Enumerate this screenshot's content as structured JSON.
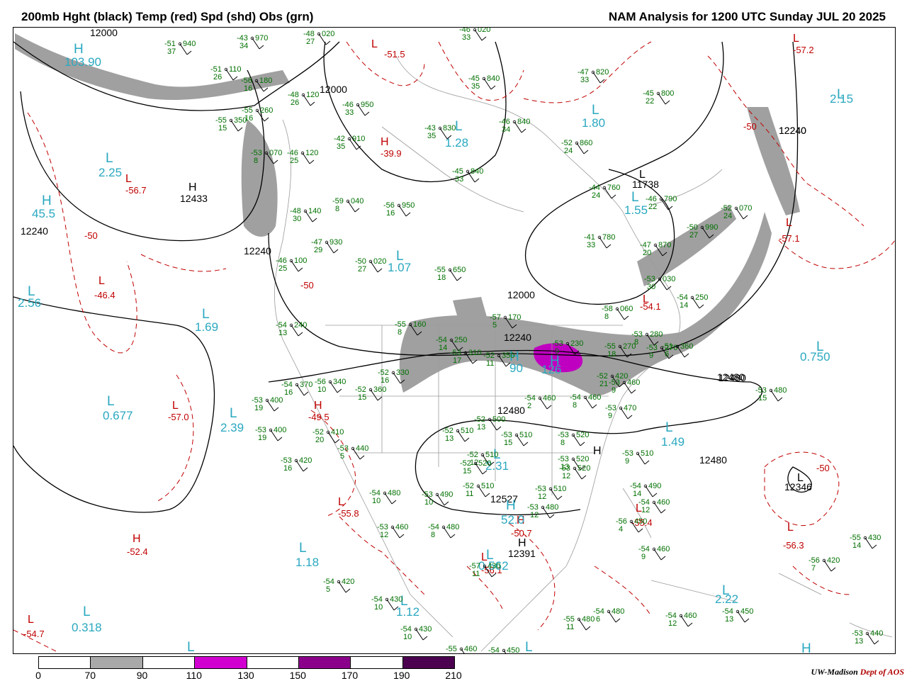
{
  "header": {
    "title_left": "200mb Hght (black) Temp (red) Spd (shd) Obs (grn)",
    "title_right": "NAM Analysis for 1200 UTC Sunday  JUL 20 2025"
  },
  "credit": {
    "org": "UW-Madison",
    "dept": "Dept of AOS"
  },
  "legend": {
    "ticks": [
      "0",
      "70",
      "90",
      "110",
      "130",
      "150",
      "170",
      "190",
      "210"
    ],
    "segments": [
      {
        "from": "0",
        "to": "70",
        "color": "#ffffff"
      },
      {
        "from": "70",
        "to": "90",
        "color": "#a9a9a9"
      },
      {
        "from": "90",
        "to": "110",
        "color": "#ffffff"
      },
      {
        "from": "110",
        "to": "130",
        "color": "#d100d1"
      },
      {
        "from": "130",
        "to": "150",
        "color": "#ffffff"
      },
      {
        "from": "150",
        "to": "170",
        "color": "#8b008b"
      },
      {
        "from": "170",
        "to": "190",
        "color": "#ffffff"
      },
      {
        "from": "190",
        "to": "210",
        "color": "#4b0050"
      }
    ]
  },
  "colors": {
    "height": "#000000",
    "temp": "#c00000",
    "speed_hi": "#a0a0a0",
    "obs": "#007000",
    "cyan": "#2aa8c0",
    "jet_core": "#c000c0"
  },
  "height_labels": [
    "12000",
    "12000",
    "12240",
    "12433",
    "12240",
    "12240",
    "11738",
    "12000",
    "12240",
    "12480",
    "12480",
    "12480",
    "12527",
    "12346",
    "12391",
    "12480",
    "12240"
  ],
  "height_centers": [
    {
      "type": "H",
      "value": "12433"
    },
    {
      "type": "L",
      "value": "11738"
    },
    {
      "type": "H",
      "value": "12527"
    },
    {
      "type": "L",
      "value": "12346"
    },
    {
      "type": "H",
      "value": "12391"
    }
  ],
  "temp_centers": [
    {
      "type": "L",
      "value": "-51.5"
    },
    {
      "type": "H",
      "value": "-39.9"
    },
    {
      "type": "L",
      "value": "-56.7"
    },
    {
      "type": "L",
      "value": "-46.4"
    },
    {
      "type": "L",
      "value": "-57.0"
    },
    {
      "type": "H",
      "value": "-49.5"
    },
    {
      "type": "L",
      "value": "-55.8"
    },
    {
      "type": "H",
      "value": "-52.4"
    },
    {
      "type": "L",
      "value": "-54.7"
    },
    {
      "type": "H",
      "value": "-50.7"
    },
    {
      "type": "L",
      "value": "-56.1"
    },
    {
      "type": "L",
      "value": "-55.4"
    },
    {
      "type": "L",
      "value": "-56.3"
    },
    {
      "type": "L",
      "value": "-57.2"
    },
    {
      "type": "L",
      "value": "-57.1"
    },
    {
      "type": "L",
      "value": "-54.1"
    }
  ],
  "temp_contour_labels": [
    "-50",
    "-50",
    "-50",
    "-50"
  ],
  "speed_centers": [
    {
      "type": "H",
      "value": "103.90"
    },
    {
      "type": "L",
      "value": "2.25"
    },
    {
      "type": "H",
      "value": "45.5"
    },
    {
      "type": "L",
      "value": "2.56"
    },
    {
      "type": "L",
      "value": "1.69"
    },
    {
      "type": "L",
      "value": "0.677"
    },
    {
      "type": "L",
      "value": "2.39"
    },
    {
      "type": "L",
      "value": "1.07"
    },
    {
      "type": "L",
      "value": "1.28"
    },
    {
      "type": "L",
      "value": "1.80"
    },
    {
      "type": "L",
      "value": "1.55"
    },
    {
      "type": "L",
      "value": "2.15"
    },
    {
      "type": "L",
      "value": "0.750"
    },
    {
      "type": "L",
      "value": "1.49"
    },
    {
      "type": "L",
      "value": "2.31"
    },
    {
      "type": "H",
      "value": "52.0"
    },
    {
      "type": "L",
      "value": "1.18"
    },
    {
      "type": "L",
      "value": "1.12"
    },
    {
      "type": "L",
      "value": "0.318"
    },
    {
      "type": "L",
      "value": "2.22"
    },
    {
      "type": "L",
      "value": "0.562"
    },
    {
      "type": "H",
      "value": "90"
    },
    {
      "type": "H",
      "value": "126"
    },
    {
      "type": "L",
      "value": ""
    },
    {
      "type": "L",
      "value": ""
    },
    {
      "type": "H",
      "value": ""
    }
  ],
  "observations": [
    {
      "t": "-43",
      "h": "970",
      "d": "34"
    },
    {
      "t": "-51",
      "h": "940",
      "d": "37"
    },
    {
      "t": "-48",
      "h": "020",
      "d": "27"
    },
    {
      "t": "-46",
      "h": "020",
      "d": "33"
    },
    {
      "t": "-51",
      "h": "110",
      "d": "26"
    },
    {
      "t": "-56",
      "h": "180",
      "d": "16"
    },
    {
      "t": "-48",
      "h": "120",
      "d": "26"
    },
    {
      "t": "-55",
      "h": "260",
      "d": "16"
    },
    {
      "t": "-55",
      "h": "350",
      "d": "15"
    },
    {
      "t": "-45",
      "h": "840",
      "d": "35"
    },
    {
      "t": "-47",
      "h": "820",
      "d": "33"
    },
    {
      "t": "-45",
      "h": "800",
      "d": "22"
    },
    {
      "t": "-46",
      "h": "950",
      "d": "33"
    },
    {
      "t": "-43",
      "h": "830",
      "d": "35"
    },
    {
      "t": "-46",
      "h": "840",
      "d": "34"
    },
    {
      "t": "-42",
      "h": "910",
      "d": "35"
    },
    {
      "t": "-52",
      "h": "860",
      "d": "24"
    },
    {
      "t": "-45",
      "h": "840",
      "d": "33"
    },
    {
      "t": "-53",
      "h": "070",
      "d": "8"
    },
    {
      "t": "-46",
      "h": "120",
      "d": "25"
    },
    {
      "t": "-44",
      "h": "760",
      "d": "24"
    },
    {
      "t": "-46",
      "h": "790",
      "d": "22"
    },
    {
      "t": "-59",
      "h": "040",
      "d": "8"
    },
    {
      "t": "-56",
      "h": "950",
      "d": "16"
    },
    {
      "t": "-48",
      "h": "140",
      "d": "30"
    },
    {
      "t": "-41",
      "h": "780",
      "d": "33"
    },
    {
      "t": "-47",
      "h": "870",
      "d": "20"
    },
    {
      "t": "-50",
      "h": "990",
      "d": "27"
    },
    {
      "t": "-52",
      "h": "070",
      "d": "24"
    },
    {
      "t": "-47",
      "h": "930",
      "d": "29"
    },
    {
      "t": "-50",
      "h": "020",
      "d": "27"
    },
    {
      "t": "-55",
      "h": "650",
      "d": "18"
    },
    {
      "t": "-46",
      "h": "100",
      "d": "25"
    },
    {
      "t": "-53",
      "h": "030",
      "d": "30"
    },
    {
      "t": "-54",
      "h": "250",
      "d": "14"
    },
    {
      "t": "-58",
      "h": "060",
      "d": "8"
    },
    {
      "t": "-54",
      "h": "240",
      "d": "13"
    },
    {
      "t": "-55",
      "h": "160",
      "d": "8"
    },
    {
      "t": "-57",
      "h": "170",
      "d": "5"
    },
    {
      "t": "-54",
      "h": "250",
      "d": "14"
    },
    {
      "t": "-53",
      "h": "310",
      "d": "17"
    },
    {
      "t": "-52",
      "h": "350",
      "d": "11"
    },
    {
      "t": "-55",
      "h": "270",
      "d": "18"
    },
    {
      "t": "-53",
      "h": "280",
      "d": "8"
    },
    {
      "t": "-53",
      "h": "270",
      "d": "9"
    },
    {
      "t": "-51",
      "h": "360",
      "d": "6"
    },
    {
      "t": "-53",
      "h": "230",
      "d": "9"
    },
    {
      "t": "-56",
      "h": "340",
      "d": "10"
    },
    {
      "t": "-52",
      "h": "330",
      "d": "16"
    },
    {
      "t": "-54",
      "h": "370",
      "d": "16"
    },
    {
      "t": "-52",
      "h": "360",
      "d": "15"
    },
    {
      "t": "-53",
      "h": "400",
      "d": "19"
    },
    {
      "t": "-52",
      "h": "420",
      "d": "21"
    },
    {
      "t": "-53",
      "h": "460",
      "d": "9"
    },
    {
      "t": "-53",
      "h": "480",
      "d": "15"
    },
    {
      "t": "-54",
      "h": "460",
      "d": "2"
    },
    {
      "t": "-54",
      "h": "460",
      "d": "8"
    },
    {
      "t": "-53",
      "h": "470",
      "d": "9"
    },
    {
      "t": "-53",
      "h": "400",
      "d": "19"
    },
    {
      "t": "-52",
      "h": "410",
      "d": "20"
    },
    {
      "t": "-52",
      "h": "500",
      "d": "13"
    },
    {
      "t": "-52",
      "h": "510",
      "d": "13"
    },
    {
      "t": "-53",
      "h": "520",
      "d": "8"
    },
    {
      "t": "-53",
      "h": "440",
      "d": "5"
    },
    {
      "t": "-52",
      "h": "510",
      "d": "12"
    },
    {
      "t": "-53",
      "h": "510",
      "d": "15"
    },
    {
      "t": "-53",
      "h": "520",
      "d": "13"
    },
    {
      "t": "-53",
      "h": "510",
      "d": "9"
    },
    {
      "t": "-53",
      "h": "420",
      "d": "16"
    },
    {
      "t": "-52",
      "h": "520",
      "d": "15"
    },
    {
      "t": "-53",
      "h": "520",
      "d": "12"
    },
    {
      "t": "-54",
      "h": "490",
      "d": "14"
    },
    {
      "t": "-54",
      "h": "480",
      "d": "10"
    },
    {
      "t": "-53",
      "h": "490",
      "d": "10"
    },
    {
      "t": "-52",
      "h": "510",
      "d": "11"
    },
    {
      "t": "-53",
      "h": "510",
      "d": "12"
    },
    {
      "t": "-53",
      "h": "480",
      "d": "12"
    },
    {
      "t": "-54",
      "h": "460",
      "d": "12"
    },
    {
      "t": "-53",
      "h": "460",
      "d": "12"
    },
    {
      "t": "-54",
      "h": "480",
      "d": "8"
    },
    {
      "t": "-56",
      "h": "450",
      "d": "4"
    },
    {
      "t": "-54",
      "h": "460",
      "d": "9"
    },
    {
      "t": "-57",
      "h": "430",
      "d": "11"
    },
    {
      "t": "-54",
      "h": "420",
      "d": "5"
    },
    {
      "t": "-54",
      "h": "430",
      "d": "10"
    },
    {
      "t": "-55",
      "h": "430",
      "d": "14"
    },
    {
      "t": "-56",
      "h": "420",
      "d": "7"
    },
    {
      "t": "-54",
      "h": "430",
      "d": "10"
    },
    {
      "t": "-55",
      "h": "480",
      "d": "11"
    },
    {
      "t": "-54",
      "h": "480",
      "d": "6"
    },
    {
      "t": "-54",
      "h": "460",
      "d": "12"
    },
    {
      "t": "-54",
      "h": "450",
      "d": "13"
    },
    {
      "t": "-55",
      "h": "460",
      "d": ""
    },
    {
      "t": "-54",
      "h": "450",
      "d": ""
    },
    {
      "t": "-53",
      "h": "440",
      "d": "13"
    }
  ]
}
